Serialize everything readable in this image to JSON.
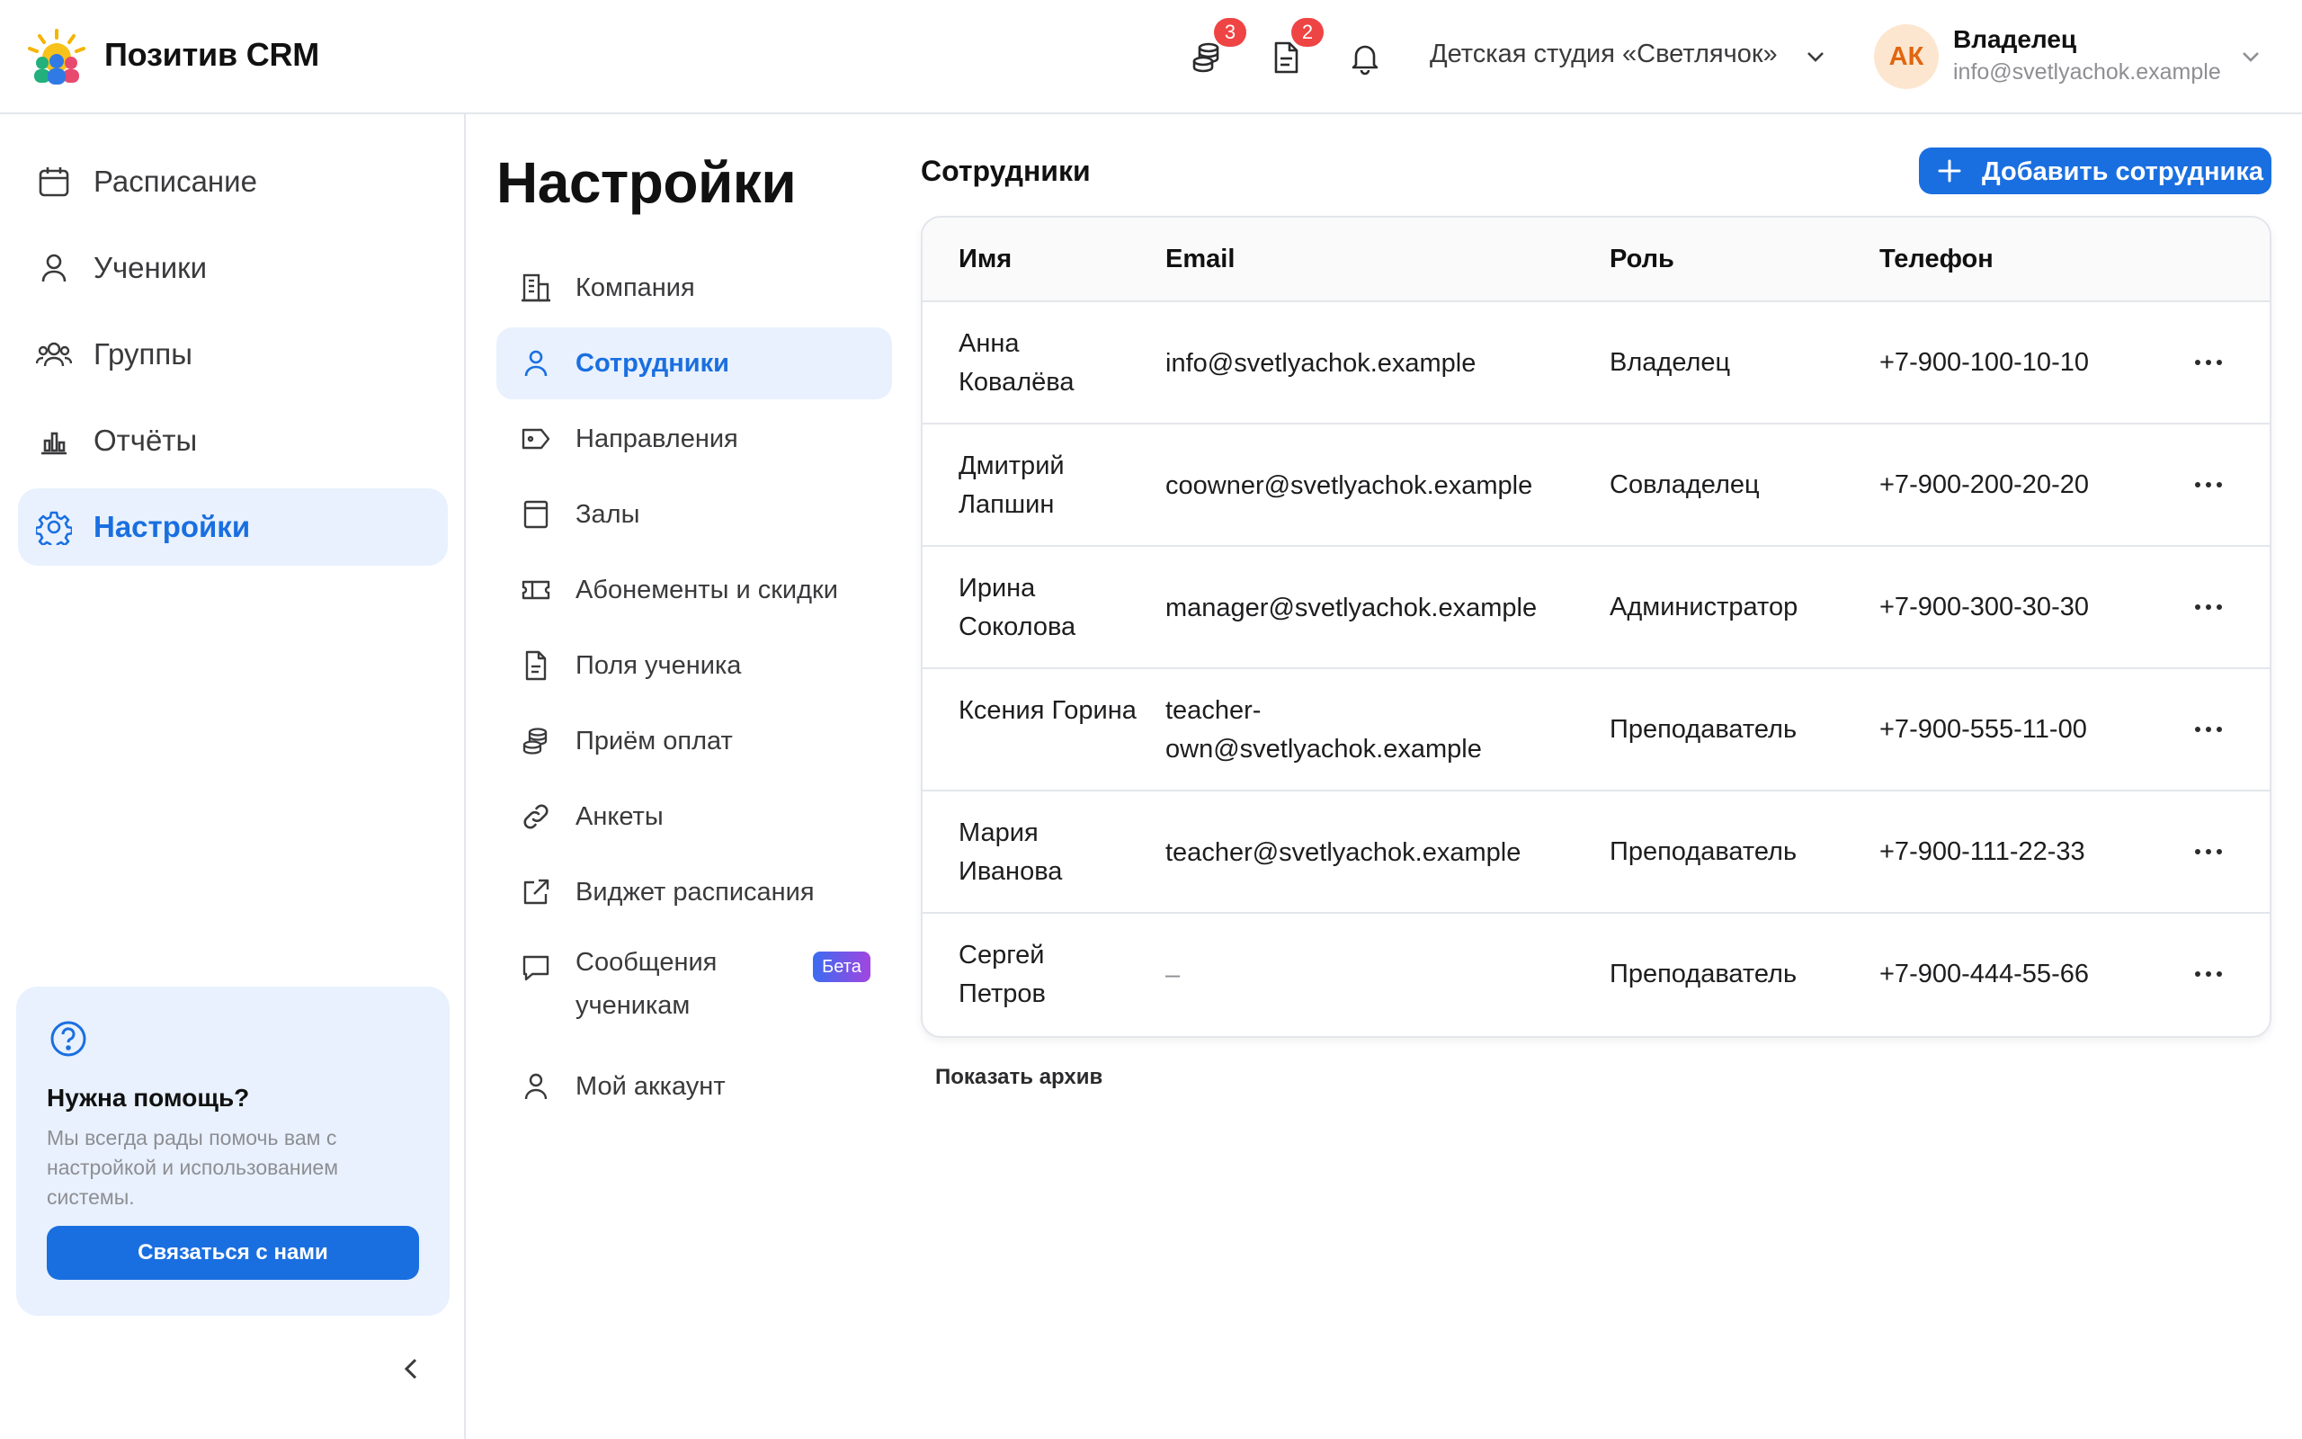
{
  "header": {
    "brand": "Позитив CRM",
    "payments_badge": "3",
    "documents_badge": "2",
    "organization": "Детская студия «Светлячок»",
    "user": {
      "initials": "АК",
      "role": "Владелец",
      "email": "info@svetlyachok.example"
    }
  },
  "sidebar": {
    "items": [
      {
        "label": "Расписание",
        "icon": "calendar-icon"
      },
      {
        "label": "Ученики",
        "icon": "user-icon"
      },
      {
        "label": "Группы",
        "icon": "users-icon"
      },
      {
        "label": "Отчёты",
        "icon": "bar-chart-icon"
      },
      {
        "label": "Настройки",
        "icon": "gear-icon",
        "active": true
      }
    ],
    "help": {
      "title": "Нужна помощь?",
      "text": "Мы всегда рады помочь вам с настройкой и использованием системы.",
      "button": "Связаться с нами"
    }
  },
  "settings": {
    "title": "Настройки",
    "items": [
      {
        "label": "Компания",
        "icon": "building-icon"
      },
      {
        "label": "Сотрудники",
        "icon": "user-icon",
        "active": true
      },
      {
        "label": "Направления",
        "icon": "tag-icon"
      },
      {
        "label": "Залы",
        "icon": "room-icon"
      },
      {
        "label": "Абонементы и скидки",
        "icon": "ticket-icon"
      },
      {
        "label": "Поля ученика",
        "icon": "document-icon"
      },
      {
        "label": "Приём оплат",
        "icon": "coins-icon"
      },
      {
        "label": "Анкеты",
        "icon": "link-icon"
      },
      {
        "label": "Виджет расписания",
        "icon": "external-link-icon"
      },
      {
        "label": "Сообщения ученикам",
        "icon": "message-icon",
        "badge": "Бета"
      },
      {
        "label": "Мой аккаунт",
        "icon": "user-icon"
      }
    ]
  },
  "employees": {
    "title": "Сотрудники",
    "add_button": "Добавить сотрудника",
    "columns": [
      "Имя",
      "Email",
      "Роль",
      "Телефон"
    ],
    "rows": [
      {
        "name": "Анна Ковалёва",
        "email": "info@svetlyachok.example",
        "role": "Владелец",
        "phone": "+7-900-100-10-10"
      },
      {
        "name": "Дмитрий Лапшин",
        "email": "coowner@svetlyachok.example",
        "role": "Совладелец",
        "phone": "+7-900-200-20-20"
      },
      {
        "name": "Ирина Соколова",
        "email": "manager@svetlyachok.example",
        "role": "Администратор",
        "phone": "+7-900-300-30-30"
      },
      {
        "name": "Ксения Горина",
        "email": "teacher-own@svetlyachok.example",
        "role": "Преподаватель",
        "phone": "+7-900-555-11-00"
      },
      {
        "name": "Мария Иванова",
        "email": "teacher@svetlyachok.example",
        "role": "Преподаватель",
        "phone": "+7-900-111-22-33"
      },
      {
        "name": "Сергей Петров",
        "email": "–",
        "role": "Преподаватель",
        "phone": "+7-900-444-55-66"
      }
    ],
    "archive_link": "Показать архив"
  },
  "colors": {
    "accent": "#1a6fe0",
    "accent_bg": "#e8f1fd",
    "badge": "#ef4444"
  }
}
